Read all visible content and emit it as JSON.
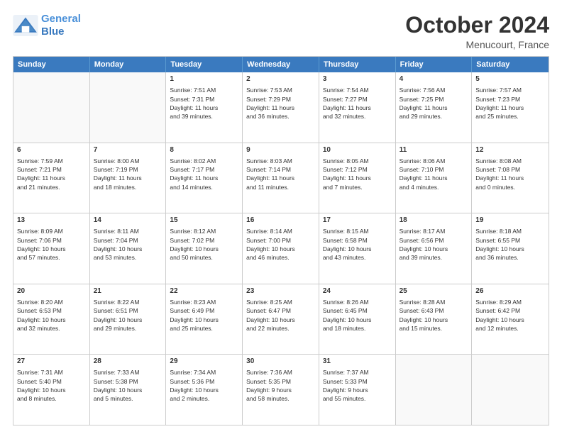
{
  "logo": {
    "line1": "General",
    "line2": "Blue"
  },
  "header": {
    "month": "October 2024",
    "location": "Menucourt, France"
  },
  "weekdays": [
    "Sunday",
    "Monday",
    "Tuesday",
    "Wednesday",
    "Thursday",
    "Friday",
    "Saturday"
  ],
  "weeks": [
    [
      {
        "day": "",
        "lines": []
      },
      {
        "day": "",
        "lines": []
      },
      {
        "day": "1",
        "lines": [
          "Sunrise: 7:51 AM",
          "Sunset: 7:31 PM",
          "Daylight: 11 hours",
          "and 39 minutes."
        ]
      },
      {
        "day": "2",
        "lines": [
          "Sunrise: 7:53 AM",
          "Sunset: 7:29 PM",
          "Daylight: 11 hours",
          "and 36 minutes."
        ]
      },
      {
        "day": "3",
        "lines": [
          "Sunrise: 7:54 AM",
          "Sunset: 7:27 PM",
          "Daylight: 11 hours",
          "and 32 minutes."
        ]
      },
      {
        "day": "4",
        "lines": [
          "Sunrise: 7:56 AM",
          "Sunset: 7:25 PM",
          "Daylight: 11 hours",
          "and 29 minutes."
        ]
      },
      {
        "day": "5",
        "lines": [
          "Sunrise: 7:57 AM",
          "Sunset: 7:23 PM",
          "Daylight: 11 hours",
          "and 25 minutes."
        ]
      }
    ],
    [
      {
        "day": "6",
        "lines": [
          "Sunrise: 7:59 AM",
          "Sunset: 7:21 PM",
          "Daylight: 11 hours",
          "and 21 minutes."
        ]
      },
      {
        "day": "7",
        "lines": [
          "Sunrise: 8:00 AM",
          "Sunset: 7:19 PM",
          "Daylight: 11 hours",
          "and 18 minutes."
        ]
      },
      {
        "day": "8",
        "lines": [
          "Sunrise: 8:02 AM",
          "Sunset: 7:17 PM",
          "Daylight: 11 hours",
          "and 14 minutes."
        ]
      },
      {
        "day": "9",
        "lines": [
          "Sunrise: 8:03 AM",
          "Sunset: 7:14 PM",
          "Daylight: 11 hours",
          "and 11 minutes."
        ]
      },
      {
        "day": "10",
        "lines": [
          "Sunrise: 8:05 AM",
          "Sunset: 7:12 PM",
          "Daylight: 11 hours",
          "and 7 minutes."
        ]
      },
      {
        "day": "11",
        "lines": [
          "Sunrise: 8:06 AM",
          "Sunset: 7:10 PM",
          "Daylight: 11 hours",
          "and 4 minutes."
        ]
      },
      {
        "day": "12",
        "lines": [
          "Sunrise: 8:08 AM",
          "Sunset: 7:08 PM",
          "Daylight: 11 hours",
          "and 0 minutes."
        ]
      }
    ],
    [
      {
        "day": "13",
        "lines": [
          "Sunrise: 8:09 AM",
          "Sunset: 7:06 PM",
          "Daylight: 10 hours",
          "and 57 minutes."
        ]
      },
      {
        "day": "14",
        "lines": [
          "Sunrise: 8:11 AM",
          "Sunset: 7:04 PM",
          "Daylight: 10 hours",
          "and 53 minutes."
        ]
      },
      {
        "day": "15",
        "lines": [
          "Sunrise: 8:12 AM",
          "Sunset: 7:02 PM",
          "Daylight: 10 hours",
          "and 50 minutes."
        ]
      },
      {
        "day": "16",
        "lines": [
          "Sunrise: 8:14 AM",
          "Sunset: 7:00 PM",
          "Daylight: 10 hours",
          "and 46 minutes."
        ]
      },
      {
        "day": "17",
        "lines": [
          "Sunrise: 8:15 AM",
          "Sunset: 6:58 PM",
          "Daylight: 10 hours",
          "and 43 minutes."
        ]
      },
      {
        "day": "18",
        "lines": [
          "Sunrise: 8:17 AM",
          "Sunset: 6:56 PM",
          "Daylight: 10 hours",
          "and 39 minutes."
        ]
      },
      {
        "day": "19",
        "lines": [
          "Sunrise: 8:18 AM",
          "Sunset: 6:55 PM",
          "Daylight: 10 hours",
          "and 36 minutes."
        ]
      }
    ],
    [
      {
        "day": "20",
        "lines": [
          "Sunrise: 8:20 AM",
          "Sunset: 6:53 PM",
          "Daylight: 10 hours",
          "and 32 minutes."
        ]
      },
      {
        "day": "21",
        "lines": [
          "Sunrise: 8:22 AM",
          "Sunset: 6:51 PM",
          "Daylight: 10 hours",
          "and 29 minutes."
        ]
      },
      {
        "day": "22",
        "lines": [
          "Sunrise: 8:23 AM",
          "Sunset: 6:49 PM",
          "Daylight: 10 hours",
          "and 25 minutes."
        ]
      },
      {
        "day": "23",
        "lines": [
          "Sunrise: 8:25 AM",
          "Sunset: 6:47 PM",
          "Daylight: 10 hours",
          "and 22 minutes."
        ]
      },
      {
        "day": "24",
        "lines": [
          "Sunrise: 8:26 AM",
          "Sunset: 6:45 PM",
          "Daylight: 10 hours",
          "and 18 minutes."
        ]
      },
      {
        "day": "25",
        "lines": [
          "Sunrise: 8:28 AM",
          "Sunset: 6:43 PM",
          "Daylight: 10 hours",
          "and 15 minutes."
        ]
      },
      {
        "day": "26",
        "lines": [
          "Sunrise: 8:29 AM",
          "Sunset: 6:42 PM",
          "Daylight: 10 hours",
          "and 12 minutes."
        ]
      }
    ],
    [
      {
        "day": "27",
        "lines": [
          "Sunrise: 7:31 AM",
          "Sunset: 5:40 PM",
          "Daylight: 10 hours",
          "and 8 minutes."
        ]
      },
      {
        "day": "28",
        "lines": [
          "Sunrise: 7:33 AM",
          "Sunset: 5:38 PM",
          "Daylight: 10 hours",
          "and 5 minutes."
        ]
      },
      {
        "day": "29",
        "lines": [
          "Sunrise: 7:34 AM",
          "Sunset: 5:36 PM",
          "Daylight: 10 hours",
          "and 2 minutes."
        ]
      },
      {
        "day": "30",
        "lines": [
          "Sunrise: 7:36 AM",
          "Sunset: 5:35 PM",
          "Daylight: 9 hours",
          "and 58 minutes."
        ]
      },
      {
        "day": "31",
        "lines": [
          "Sunrise: 7:37 AM",
          "Sunset: 5:33 PM",
          "Daylight: 9 hours",
          "and 55 minutes."
        ]
      },
      {
        "day": "",
        "lines": []
      },
      {
        "day": "",
        "lines": []
      }
    ]
  ]
}
